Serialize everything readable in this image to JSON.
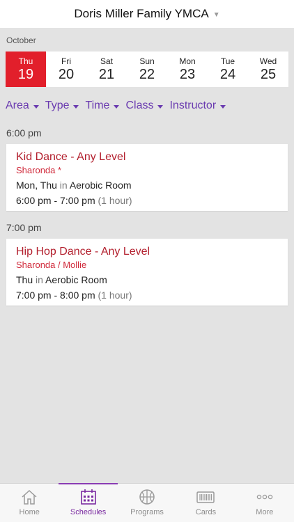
{
  "header": {
    "title": "Doris Miller Family YMCA"
  },
  "month": "October",
  "days": [
    {
      "name": "Thu",
      "num": "19",
      "selected": true
    },
    {
      "name": "Fri",
      "num": "20"
    },
    {
      "name": "Sat",
      "num": "21"
    },
    {
      "name": "Sun",
      "num": "22"
    },
    {
      "name": "Mon",
      "num": "23"
    },
    {
      "name": "Tue",
      "num": "24"
    },
    {
      "name": "Wed",
      "num": "25"
    }
  ],
  "filters": [
    "Area",
    "Type",
    "Time",
    "Class",
    "Instructor"
  ],
  "sections": [
    {
      "time": "6:00 pm",
      "cls": {
        "name": "Kid Dance - Any Level",
        "instructor": "Sharonda *",
        "days": "Mon, Thu",
        "in": "in",
        "room": "Aerobic Room",
        "time": "6:00 pm - 7:00 pm",
        "duration": "(1 hour)"
      }
    },
    {
      "time": "7:00 pm",
      "cls": {
        "name": "Hip Hop Dance - Any Level",
        "instructor": "Sharonda / Mollie",
        "days": "Thu",
        "in": "in",
        "room": "Aerobic Room",
        "time": "7:00 pm - 8:00 pm",
        "duration": "(1 hour)"
      }
    }
  ],
  "tabs": [
    {
      "label": "Home",
      "icon": "home-icon"
    },
    {
      "label": "Schedules",
      "icon": "calendar-icon",
      "active": true
    },
    {
      "label": "Programs",
      "icon": "basketball-icon"
    },
    {
      "label": "Cards",
      "icon": "barcode-card-icon"
    },
    {
      "label": "More",
      "icon": "more-dots-icon"
    }
  ],
  "colors": {
    "accent": "#e21f2b",
    "purple": "#6a3bb0",
    "class_red": "#b3202e"
  }
}
